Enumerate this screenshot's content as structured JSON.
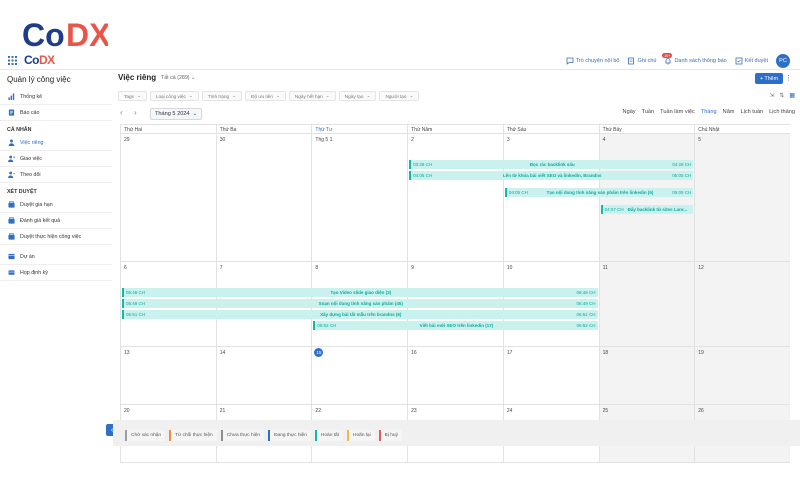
{
  "brand": {
    "name": "CoDX",
    "small": "CoDX"
  },
  "header": {
    "actions": [
      {
        "label": "Trò chuyện nội bộ",
        "icon": "chat-icon"
      },
      {
        "label": "Ghi chú",
        "icon": "note-icon"
      },
      {
        "label": "Danh sách thông báo",
        "icon": "bell-icon",
        "badge": "10+"
      },
      {
        "label": "Kết duyệt",
        "icon": "approval-icon"
      }
    ],
    "avatar": "PC"
  },
  "sidebar": {
    "title": "Quản lý công việc",
    "top_items": [
      {
        "label": "Thống kê",
        "icon": "chart-icon"
      },
      {
        "label": "Báo cáo",
        "icon": "report-icon"
      }
    ],
    "sections": [
      {
        "title": "CÁ NHÂN",
        "items": [
          {
            "label": "Việc riêng",
            "icon": "person-icon",
            "active": true
          },
          {
            "label": "Giao việc",
            "icon": "assign-icon"
          },
          {
            "label": "Theo dõi",
            "icon": "follow-icon"
          }
        ]
      },
      {
        "title": "XÉT DUYỆT",
        "items": [
          {
            "label": "Duyệt gia hạn",
            "icon": "extend-icon"
          },
          {
            "label": "Đánh giá kết quả",
            "icon": "evaluate-icon"
          },
          {
            "label": "Duyệt thực hiện công việc",
            "icon": "approve-task-icon"
          }
        ]
      },
      {
        "title": "",
        "items": [
          {
            "label": "Dự án",
            "icon": "project-icon"
          },
          {
            "label": "Họp định kỳ",
            "icon": "meeting-icon"
          }
        ]
      }
    ]
  },
  "main": {
    "title": "Việc riêng",
    "filter_all": "Tất cả (289)",
    "add_label": "+ Thêm",
    "filters": [
      "Tags",
      "Loại công việc",
      "Tình trạng",
      "Độ ưu tiên",
      "Ngày hết hạn",
      "Ngày tạo",
      "Người tạo"
    ],
    "month": "Tháng 5 2024",
    "views": [
      "Ngày",
      "Tuần",
      "Tuần làm việc",
      "Tháng",
      "Năm",
      "Lịch tuần",
      "Lịch tháng"
    ],
    "active_view": "Tháng"
  },
  "calendar": {
    "weekdays": [
      "Thứ Hai",
      "Thứ Ba",
      "Thứ Tư",
      "Thứ Năm",
      "Thứ Sáu",
      "Thứ Bảy",
      "Chủ Nhật"
    ],
    "weeks": [
      {
        "days": [
          "29",
          "30",
          "Thg 5 1",
          "2",
          "3",
          "4",
          "5"
        ],
        "height": 128
      },
      {
        "days": [
          "6",
          "7",
          "8",
          "9",
          "10",
          "11",
          "12"
        ],
        "height": 85
      },
      {
        "days": [
          "13",
          "14",
          "15",
          "16",
          "17",
          "18",
          "19"
        ],
        "height": 58
      },
      {
        "days": [
          "20",
          "21",
          "22",
          "23",
          "24",
          "25",
          "26"
        ],
        "height": 58
      }
    ],
    "today": "15",
    "events": [
      {
        "week": 0,
        "start": 3,
        "end": 6,
        "row": 0,
        "start_time": "03:28 CH",
        "title": "Đọc rác backlink sẩu",
        "end_time": "04:28 CH"
      },
      {
        "week": 0,
        "start": 3,
        "end": 6,
        "row": 1,
        "start_time": "04:05 CH",
        "title": "Lên từ khóa bài viết SEO và linkedin, Brandns",
        "end_time": "05:05 CH"
      },
      {
        "week": 0,
        "start": 4,
        "end": 6,
        "row": 2,
        "start_time": "04:05 CH",
        "title": "Tạo nội dung tính năng sản phẩm trên linkedin (5)",
        "end_time": "05:05 CH"
      },
      {
        "week": 0,
        "start": 5,
        "end": 6,
        "row": 3,
        "start_time": "04:07 CH",
        "title": "Đẩy backlink từ sites Lanr...",
        "end_time": ""
      },
      {
        "week": 1,
        "start": 0,
        "end": 5,
        "row": 0,
        "start_time": "05:48 CH",
        "title": "Tạo Video slide giao diện (3)",
        "end_time": "06:48 CH"
      },
      {
        "week": 1,
        "start": 0,
        "end": 5,
        "row": 1,
        "start_time": "05:49 CH",
        "title": "Soạn nội dung tính năng sản phẩm (45)",
        "end_time": "06:49 CH"
      },
      {
        "week": 1,
        "start": 0,
        "end": 5,
        "row": 2,
        "start_time": "05:51 CH",
        "title": "Xây dựng bài tất mẫu trên brandns (6)",
        "end_time": "06:51 CH"
      },
      {
        "week": 1,
        "start": 2,
        "end": 5,
        "row": 3,
        "start_time": "05:52 CH",
        "title": "Viết bài mới SEO trên linkedin (17)",
        "end_time": "06:52 CH"
      }
    ]
  },
  "legend": [
    {
      "label": "Chờ xác nhận",
      "color": "#9e9e9e"
    },
    {
      "label": "Từ chối thực hiện",
      "color": "#f08a3c"
    },
    {
      "label": "Chưa thực hiện",
      "color": "#8d8d8d"
    },
    {
      "label": "Đang thực hiện",
      "color": "#2f6fc9"
    },
    {
      "label": "Hoàn tất",
      "color": "#12b8aa"
    },
    {
      "label": "Hoãn lại",
      "color": "#f2b94a"
    },
    {
      "label": "Bị huỷ",
      "color": "#e25b5b"
    }
  ],
  "colors": {
    "accent": "#2f6fc9",
    "event_bg": "#c9f1ee",
    "event_text": "#0ea99b"
  }
}
